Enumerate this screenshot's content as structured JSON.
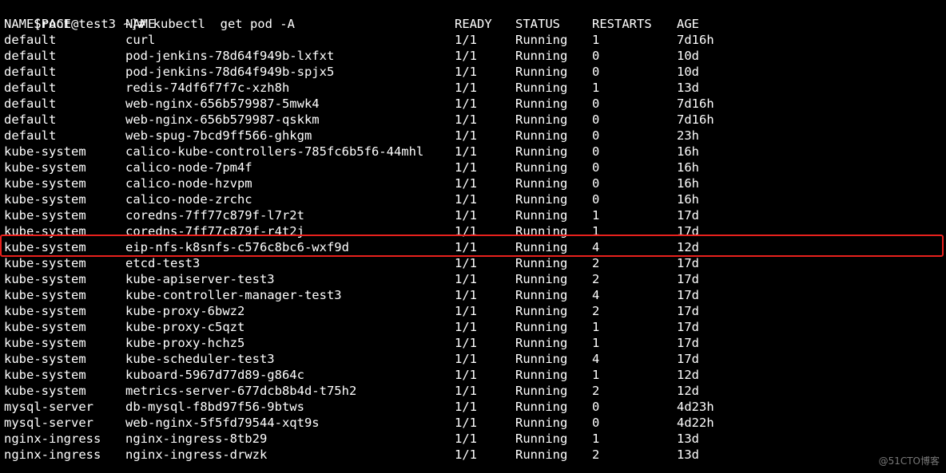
{
  "terminal": {
    "prompt": "[root@test3 ~]#",
    "command": "kubectl  get pod -A",
    "headers": {
      "namespace": "NAMESPACE",
      "name": "NAME",
      "ready": "READY",
      "status": "STATUS",
      "restarts": "RESTARTS",
      "age": "AGE"
    },
    "rows": [
      {
        "namespace": "default",
        "name": "curl",
        "ready": "1/1",
        "status": "Running",
        "restarts": "1",
        "age": "7d16h"
      },
      {
        "namespace": "default",
        "name": "pod-jenkins-78d64f949b-lxfxt",
        "ready": "1/1",
        "status": "Running",
        "restarts": "0",
        "age": "10d"
      },
      {
        "namespace": "default",
        "name": "pod-jenkins-78d64f949b-spjx5",
        "ready": "1/1",
        "status": "Running",
        "restarts": "0",
        "age": "10d"
      },
      {
        "namespace": "default",
        "name": "redis-74df6f7f7c-xzh8h",
        "ready": "1/1",
        "status": "Running",
        "restarts": "1",
        "age": "13d"
      },
      {
        "namespace": "default",
        "name": "web-nginx-656b579987-5mwk4",
        "ready": "1/1",
        "status": "Running",
        "restarts": "0",
        "age": "7d16h"
      },
      {
        "namespace": "default",
        "name": "web-nginx-656b579987-qskkm",
        "ready": "1/1",
        "status": "Running",
        "restarts": "0",
        "age": "7d16h"
      },
      {
        "namespace": "default",
        "name": "web-spug-7bcd9ff566-ghkgm",
        "ready": "1/1",
        "status": "Running",
        "restarts": "0",
        "age": "23h"
      },
      {
        "namespace": "kube-system",
        "name": "calico-kube-controllers-785fc6b5f6-44mhl",
        "ready": "1/1",
        "status": "Running",
        "restarts": "0",
        "age": "16h"
      },
      {
        "namespace": "kube-system",
        "name": "calico-node-7pm4f",
        "ready": "1/1",
        "status": "Running",
        "restarts": "0",
        "age": "16h"
      },
      {
        "namespace": "kube-system",
        "name": "calico-node-hzvpm",
        "ready": "1/1",
        "status": "Running",
        "restarts": "0",
        "age": "16h"
      },
      {
        "namespace": "kube-system",
        "name": "calico-node-zrchc",
        "ready": "1/1",
        "status": "Running",
        "restarts": "0",
        "age": "16h"
      },
      {
        "namespace": "kube-system",
        "name": "coredns-7ff77c879f-l7r2t",
        "ready": "1/1",
        "status": "Running",
        "restarts": "1",
        "age": "17d"
      },
      {
        "namespace": "kube-system",
        "name": "coredns-7ff77c879f-r4t2j",
        "ready": "1/1",
        "status": "Running",
        "restarts": "1",
        "age": "17d"
      },
      {
        "namespace": "kube-system",
        "name": "eip-nfs-k8snfs-c576c8bc6-wxf9d",
        "ready": "1/1",
        "status": "Running",
        "restarts": "4",
        "age": "12d",
        "highlighted": true
      },
      {
        "namespace": "kube-system",
        "name": "etcd-test3",
        "ready": "1/1",
        "status": "Running",
        "restarts": "2",
        "age": "17d"
      },
      {
        "namespace": "kube-system",
        "name": "kube-apiserver-test3",
        "ready": "1/1",
        "status": "Running",
        "restarts": "2",
        "age": "17d"
      },
      {
        "namespace": "kube-system",
        "name": "kube-controller-manager-test3",
        "ready": "1/1",
        "status": "Running",
        "restarts": "4",
        "age": "17d"
      },
      {
        "namespace": "kube-system",
        "name": "kube-proxy-6bwz2",
        "ready": "1/1",
        "status": "Running",
        "restarts": "2",
        "age": "17d"
      },
      {
        "namespace": "kube-system",
        "name": "kube-proxy-c5qzt",
        "ready": "1/1",
        "status": "Running",
        "restarts": "1",
        "age": "17d"
      },
      {
        "namespace": "kube-system",
        "name": "kube-proxy-hchz5",
        "ready": "1/1",
        "status": "Running",
        "restarts": "1",
        "age": "17d"
      },
      {
        "namespace": "kube-system",
        "name": "kube-scheduler-test3",
        "ready": "1/1",
        "status": "Running",
        "restarts": "4",
        "age": "17d"
      },
      {
        "namespace": "kube-system",
        "name": "kuboard-5967d77d89-g864c",
        "ready": "1/1",
        "status": "Running",
        "restarts": "1",
        "age": "12d"
      },
      {
        "namespace": "kube-system",
        "name": "metrics-server-677dcb8b4d-t75h2",
        "ready": "1/1",
        "status": "Running",
        "restarts": "2",
        "age": "12d"
      },
      {
        "namespace": "mysql-server",
        "name": "db-mysql-f8bd97f56-9btws",
        "ready": "1/1",
        "status": "Running",
        "restarts": "0",
        "age": "4d23h"
      },
      {
        "namespace": "mysql-server",
        "name": "web-nginx-5f5fd79544-xqt9s",
        "ready": "1/1",
        "status": "Running",
        "restarts": "0",
        "age": "4d22h"
      },
      {
        "namespace": "nginx-ingress",
        "name": "nginx-ingress-8tb29",
        "ready": "1/1",
        "status": "Running",
        "restarts": "1",
        "age": "13d"
      },
      {
        "namespace": "nginx-ingress",
        "name": "nginx-ingress-drwzk",
        "ready": "1/1",
        "status": "Running",
        "restarts": "2",
        "age": "13d"
      }
    ],
    "cursor_color": "#00ff00",
    "highlight_color": "#e8211d"
  },
  "watermark": {
    "text": "@51CTO博客"
  }
}
